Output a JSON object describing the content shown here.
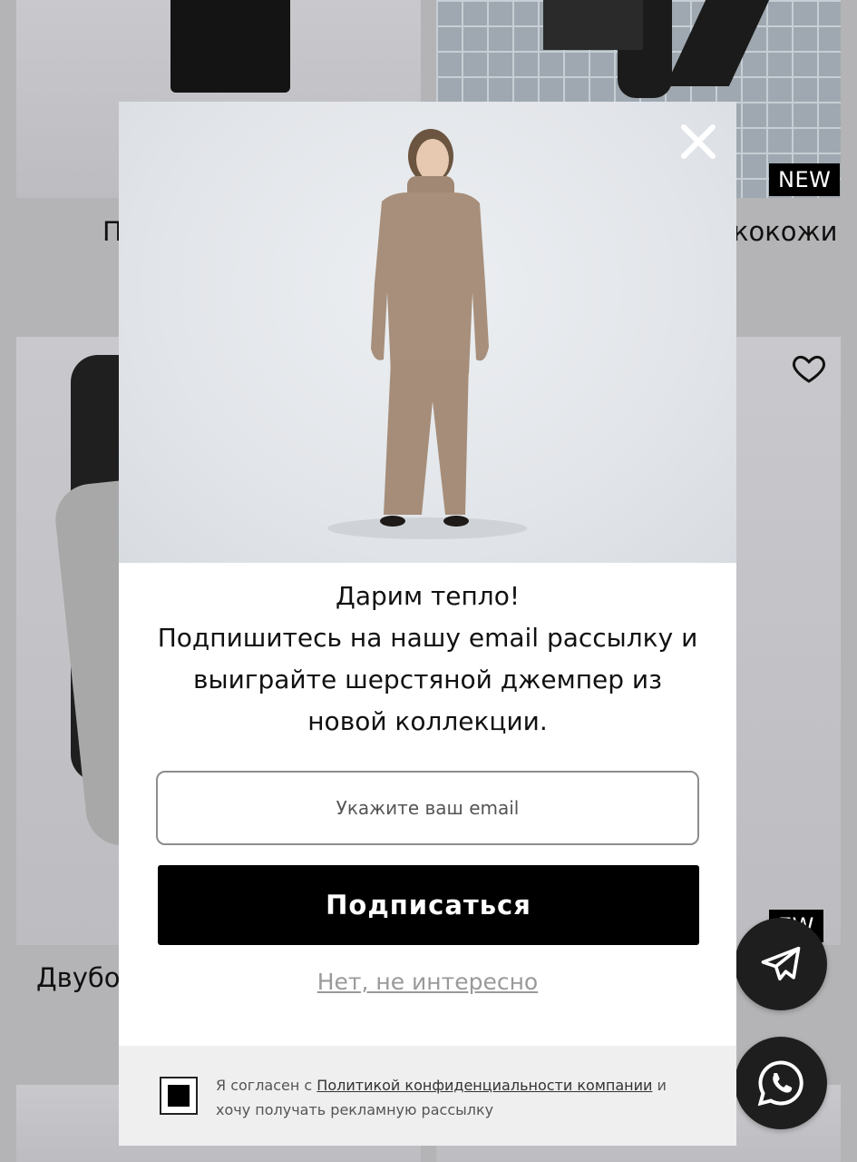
{
  "background": {
    "cards": [
      {
        "title_fragment": "П"
      },
      {
        "title_fragment": "кокожи",
        "badge": "NEW"
      },
      {
        "title_fragment": "Двубо"
      },
      {
        "badge": "EW"
      }
    ]
  },
  "popup": {
    "heading": "Дарим тепло!",
    "body_lines": [
      "Подпишитесь на нашу email рассылку и",
      "выиграйте шерстяной джемпер из",
      "новой коллекции."
    ],
    "email_placeholder": "Укажите ваш email",
    "subscribe_label": "Подписаться",
    "decline_label": "Нет, не интересно",
    "consent": {
      "checked": true,
      "text_before": "Я согласен с ",
      "link_text": "Политикой конфиденциальности компании",
      "text_after": " и хочу получать рекламную рассылку"
    }
  },
  "floating_buttons": [
    "telegram-icon",
    "whatsapp-icon"
  ],
  "colors": {
    "accent": "#000000",
    "overlay": "#b4b4b6",
    "muted_link": "#9a9a9a"
  }
}
